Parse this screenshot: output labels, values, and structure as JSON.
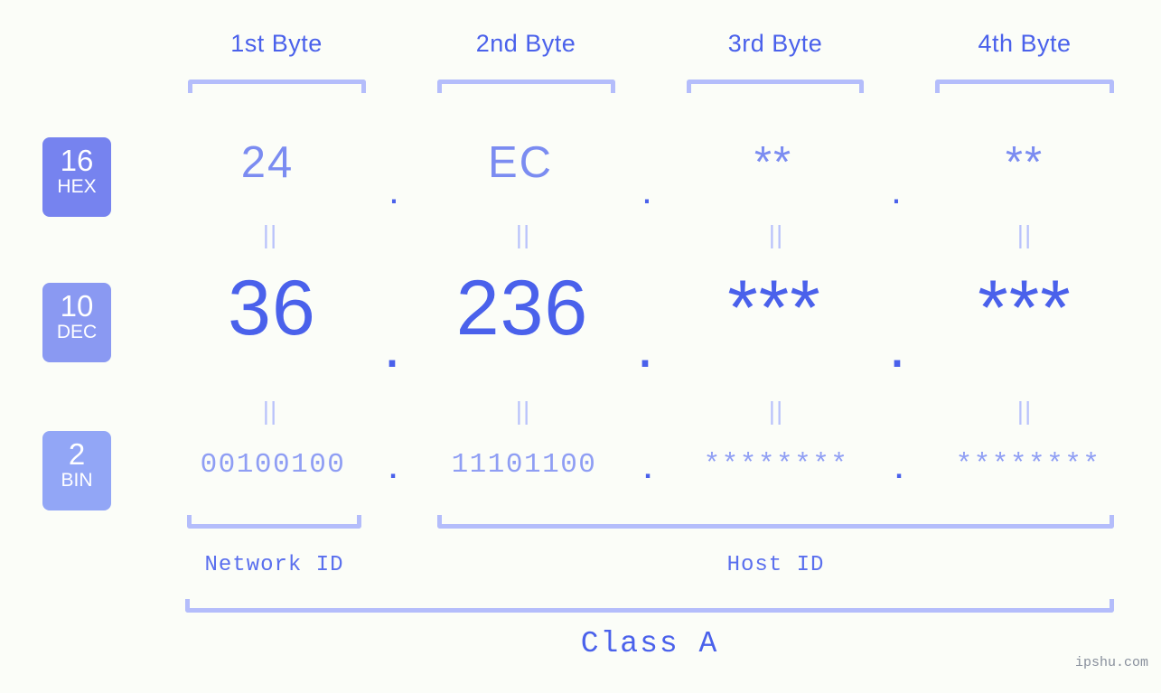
{
  "meta": {
    "background_color": "#fbfdf8",
    "accent_color": "#4a61eb",
    "accent_light_color": "#8f9ef4",
    "bracket_color": "#b4bdfb",
    "watermark": "ipshu.com"
  },
  "byte_headers": [
    {
      "label": "1st Byte"
    },
    {
      "label": "2nd Byte"
    },
    {
      "label": "3rd Byte"
    },
    {
      "label": "4th Byte"
    }
  ],
  "bases": [
    {
      "number": "16",
      "name": "HEX",
      "color": "#7683ef"
    },
    {
      "number": "10",
      "name": "DEC",
      "color": "#8a99f2"
    },
    {
      "number": "2",
      "name": "BIN",
      "color": "#92a6f6"
    }
  ],
  "separators": {
    "dot": ".",
    "equals": "||"
  },
  "rows": {
    "hex": {
      "base_number": "16",
      "base_name": "HEX",
      "values": [
        "24",
        "EC",
        "**",
        "**"
      ]
    },
    "dec": {
      "base_number": "10",
      "base_name": "DEC",
      "values": [
        "36",
        "236",
        "***",
        "***"
      ]
    },
    "bin": {
      "base_number": "2",
      "base_name": "BIN",
      "values": [
        "00100100",
        "11101100",
        "********",
        "********"
      ]
    }
  },
  "groups": {
    "network_id": "Network ID",
    "host_id": "Host ID",
    "class": "Class A"
  }
}
